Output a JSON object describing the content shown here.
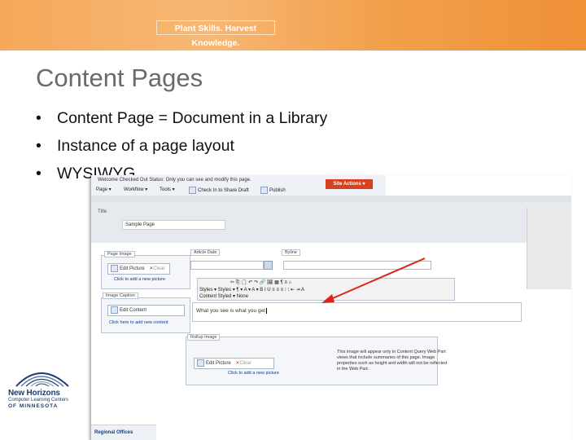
{
  "header": {
    "tagline": "Plant Skills. Harvest Knowledge."
  },
  "slide": {
    "title": "Content Pages",
    "bullets": [
      "Content Page = Document in a Library",
      "Instance of a page layout",
      "WYSIWYG"
    ]
  },
  "logo": {
    "line1": "New Horizons",
    "line2": "Computer Learning Centers",
    "line3": "OF MINNESOTA"
  },
  "screenshot": {
    "status": "Welcome  Checked Out    Status: Only you can see and modify this page.",
    "menu": {
      "page": "Page ▾",
      "workflow": "Workflow ▾",
      "tools": "Tools ▾",
      "checkin": "Check In to Share Draft",
      "publish": "Publish"
    },
    "site_actions": "Site Actions ▾",
    "title_label": "Title",
    "title_value": "Sample Page",
    "page_image_label": "Page Image",
    "article_date_label": "Article Date",
    "byline_label": "Byline",
    "edit_picture": "Edit Picture",
    "clear": "Clear",
    "click_add_picture": "Click to add a new picture",
    "image_caption_label": "Image Caption",
    "edit_content": "Edit Content",
    "click_add_content": "Click here to add new content",
    "toolbar_row1": "✂ ⎘ 📋 ↶ ↷ 🔗 🖼 ▦ ¶ ≡ ⌂",
    "toolbar_row2": "Styles ▾  Styles ▾  ¶ ▾  A ▾  A ▾  B  I  U  ≡ ≡ ≡  ⁝ ⁝  ⇤ ⇥  A",
    "toolbar_row3": "Content  Styled  ▾  None",
    "editor_text": "What you see is what you get",
    "rollup_image_label": "Rollup Image",
    "description": "This image will appear only in Content Query Web Part views that include summaries of this page. Image properties such as height and width will not be reflected in the Web Part.",
    "regional_offices": "Regional Offices"
  },
  "colors": {
    "banner": "#f29a45",
    "arrow": "#d9261c",
    "title_text": "#6a6a6a",
    "site_actions": "#d9401e"
  }
}
